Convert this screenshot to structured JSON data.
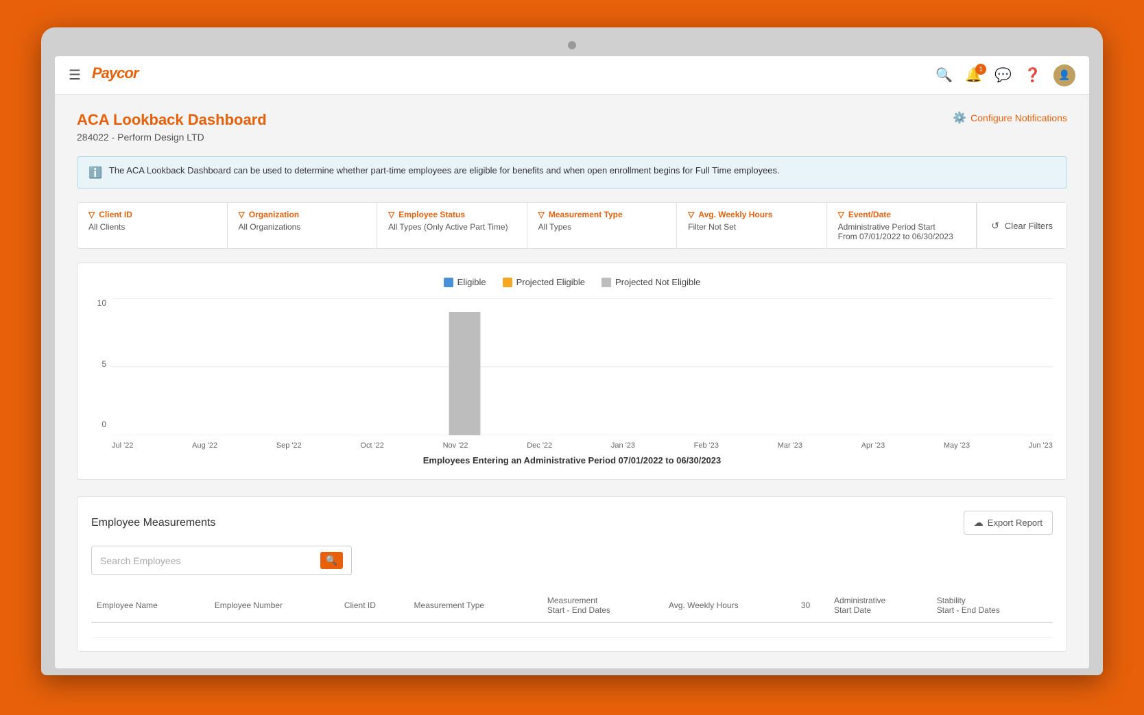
{
  "app": {
    "title": "Paycor",
    "logo_text": "Paycor"
  },
  "topbar": {
    "notification_count": "1"
  },
  "page": {
    "title": "ACA Lookback Dashboard",
    "subtitle": "284022 - Perform Design LTD",
    "configure_label": "Configure Notifications"
  },
  "info_banner": {
    "text": "The ACA Lookback Dashboard can be used to determine whether part-time employees are eligible for benefits and when open enrollment begins for Full Time employees."
  },
  "filters": {
    "client_id": {
      "label": "Client ID",
      "value": "All Clients"
    },
    "organization": {
      "label": "Organization",
      "value": "All Organizations"
    },
    "employee_status": {
      "label": "Employee Status",
      "value": "All Types (Only Active Part Time)"
    },
    "measurement_type": {
      "label": "Measurement Type",
      "value": "All Types"
    },
    "avg_weekly_hours": {
      "label": "Avg. Weekly Hours",
      "value": "Filter Not Set"
    },
    "event_date": {
      "label": "Event/Date",
      "value": "Administrative Period Start\nFrom 07/01/2022 to 06/30/2023"
    },
    "clear_filters_label": "Clear Filters"
  },
  "chart": {
    "legend": {
      "eligible": "Eligible",
      "projected_eligible": "Projected Eligible",
      "projected_not_eligible": "Projected Not Eligible"
    },
    "x_axis_labels": [
      "Jul '22",
      "Aug '22",
      "Sep '22",
      "Oct '22",
      "Nov '22",
      "Dec '22",
      "Jan '23",
      "Feb '23",
      "Mar '23",
      "Apr '23",
      "May '23",
      "Jun '23"
    ],
    "y_axis_labels": [
      "0",
      "5",
      "10"
    ],
    "xlabel": "Employees Entering an Administrative Period 07/01/2022 to 06/30/2023",
    "bars": [
      {
        "month": "Jul '22",
        "eligible": 0,
        "projected_eligible": 0,
        "projected_not_eligible": 0
      },
      {
        "month": "Aug '22",
        "eligible": 0,
        "projected_eligible": 0,
        "projected_not_eligible": 0
      },
      {
        "month": "Sep '22",
        "eligible": 0,
        "projected_eligible": 0,
        "projected_not_eligible": 0
      },
      {
        "month": "Oct '22",
        "eligible": 0,
        "projected_eligible": 0,
        "projected_not_eligible": 0
      },
      {
        "month": "Nov '22",
        "eligible": 0,
        "projected_eligible": 0,
        "projected_not_eligible": 9
      },
      {
        "month": "Dec '22",
        "eligible": 0,
        "projected_eligible": 0,
        "projected_not_eligible": 0
      },
      {
        "month": "Jan '23",
        "eligible": 0,
        "projected_eligible": 0,
        "projected_not_eligible": 0
      },
      {
        "month": "Feb '23",
        "eligible": 0,
        "projected_eligible": 0,
        "projected_not_eligible": 0
      },
      {
        "month": "Mar '23",
        "eligible": 0,
        "projected_eligible": 0,
        "projected_not_eligible": 0
      },
      {
        "month": "Apr '23",
        "eligible": 0,
        "projected_eligible": 0,
        "projected_not_eligible": 0
      },
      {
        "month": "May '23",
        "eligible": 0,
        "projected_eligible": 0,
        "projected_not_eligible": 0
      },
      {
        "month": "Jun '23",
        "eligible": 0,
        "projected_eligible": 0,
        "projected_not_eligible": 0
      }
    ]
  },
  "employee_measurements": {
    "title": "Employee Measurements",
    "export_label": "Export Report",
    "search_placeholder": "Search Employees",
    "table_headers": [
      "Employee Name",
      "Employee Number",
      "Client ID",
      "Measurement Type",
      "Measurement\nStart - End Dates",
      "Avg. Weekly Hours",
      "30",
      "Administrative\nStart Date",
      "Stability\nStart - End Dates"
    ]
  }
}
